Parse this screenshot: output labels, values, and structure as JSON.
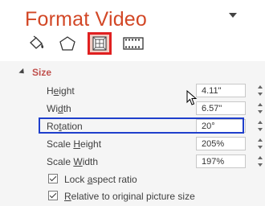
{
  "pane": {
    "title": "Format Video",
    "accent": "#d24726",
    "tabs": [
      {
        "icon": "fill-line-icon",
        "active": false
      },
      {
        "icon": "effects-icon",
        "active": false
      },
      {
        "icon": "size-properties-icon",
        "active": true
      },
      {
        "icon": "video-icon",
        "active": false
      }
    ]
  },
  "size_section": {
    "heading": "Size",
    "rows": [
      {
        "label_pre": "H",
        "label_ul": "e",
        "label_post": "ight",
        "value": "4.11\""
      },
      {
        "label_pre": "Wi",
        "label_ul": "d",
        "label_post": "th",
        "value": "6.57\""
      },
      {
        "label_pre": "Ro",
        "label_ul": "t",
        "label_post": "ation",
        "value": "20°"
      },
      {
        "label_pre": "Scale ",
        "label_ul": "H",
        "label_post": "eight",
        "value": "205%"
      },
      {
        "label_pre": "Scale ",
        "label_ul": "W",
        "label_post": "idth",
        "value": "197%"
      }
    ],
    "checkboxes": [
      {
        "label_pre": "Lock ",
        "label_ul": "a",
        "label_post": "spect ratio",
        "checked": true
      },
      {
        "label_pre": "",
        "label_ul": "R",
        "label_post": "elative to original picture size",
        "checked": true
      }
    ],
    "highlight_color": "#1f3fcc"
  }
}
